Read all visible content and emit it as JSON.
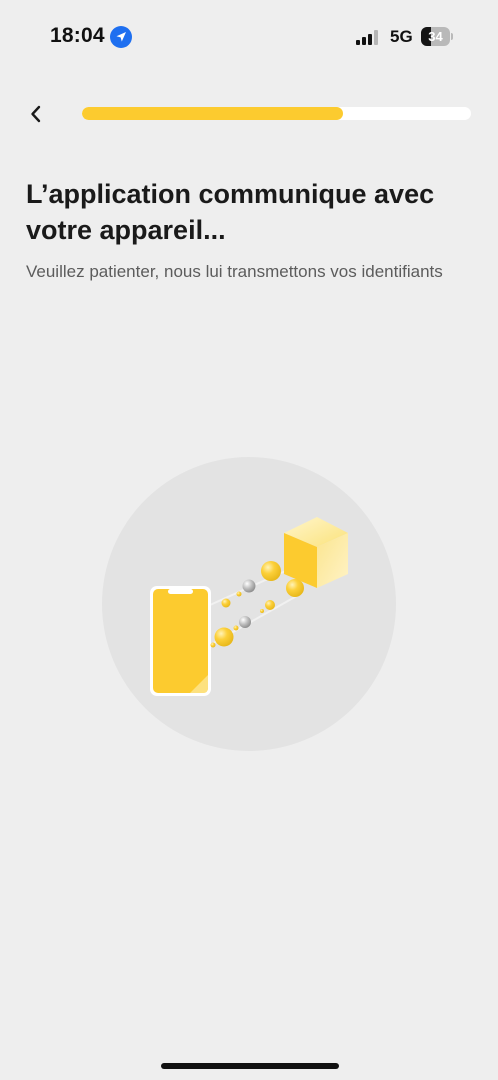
{
  "status_bar": {
    "time": "18:04",
    "network": "5G",
    "battery_level": "34",
    "battery_fraction": 0.34
  },
  "header": {
    "progress_fraction": 0.67,
    "progress_color": "#fccb2f"
  },
  "content": {
    "title": "L’application communique avec votre appareil...",
    "subtitle": "Veuillez patienter, nous lui transmettons vos identifiants"
  },
  "icons": {
    "back": "chevron-left-icon",
    "location": "location-arrow-icon",
    "signal": "cellular-signal-icon",
    "battery": "battery-icon"
  },
  "colors": {
    "background": "#eeeeee",
    "accent": "#fccb2f",
    "illustration_circle": "#e3e3e3",
    "location_badge": "#1e6ff0"
  }
}
